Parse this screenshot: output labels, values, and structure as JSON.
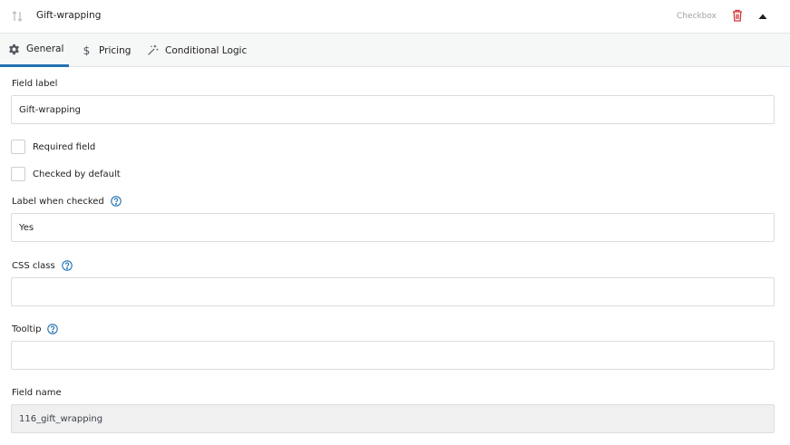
{
  "header": {
    "title": "Gift-wrapping",
    "type": "Checkbox",
    "icons": {
      "sort": "sort-arrows-icon",
      "delete": "trash-icon",
      "toggle": "caret-up-icon"
    },
    "colors": {
      "delete": "#d63638"
    }
  },
  "tabs": [
    {
      "label": "General",
      "icon": "gear-icon",
      "active": true
    },
    {
      "label": "Pricing",
      "icon": "dollar-icon",
      "active": false
    },
    {
      "label": "Conditional Logic",
      "icon": "magic-wand-icon",
      "active": false
    }
  ],
  "form": {
    "field_label": {
      "label": "Field label",
      "value": "Gift-wrapping"
    },
    "required": {
      "label": "Required field",
      "checked": false
    },
    "checked_default": {
      "label": "Checked by default",
      "checked": false
    },
    "label_when_checked": {
      "label": "Label when checked",
      "value": "Yes"
    },
    "css_class": {
      "label": "CSS class",
      "value": ""
    },
    "tooltip": {
      "label": "Tooltip",
      "value": ""
    },
    "field_name": {
      "label": "Field name",
      "value": "116_gift_wrapping"
    }
  },
  "colors": {
    "accent": "#2271b1"
  }
}
